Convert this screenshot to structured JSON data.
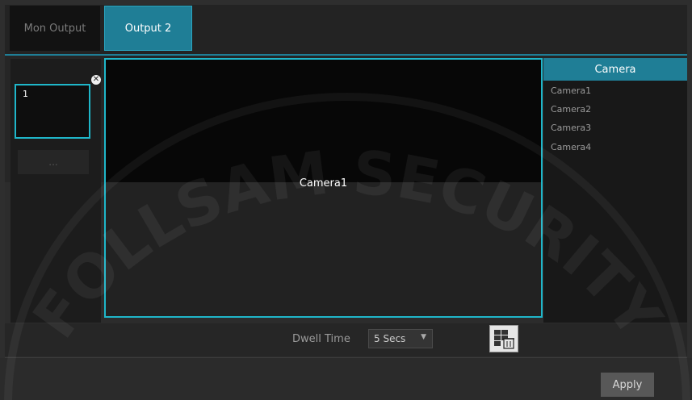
{
  "tabs": [
    {
      "label": "Mon Output"
    },
    {
      "label": "Output 2"
    }
  ],
  "sequence": {
    "thumb_number": "1",
    "add_button_label": "..."
  },
  "preview": {
    "label": "Camera1"
  },
  "camera_list": {
    "header": "Camera",
    "items": [
      "Camera1",
      "Camera2",
      "Camera3",
      "Camera4"
    ]
  },
  "dwell": {
    "label": "Dwell Time",
    "value": "5 Secs"
  },
  "footer": {
    "apply_label": "Apply"
  },
  "watermark": {
    "text": "FOLLSAM SECURITY"
  },
  "colors": {
    "accent": "#1f7e96",
    "border_highlight": "#1fb6c9",
    "background": "#262626"
  },
  "icons": {
    "thumb_close": "close-icon",
    "dwell_dropdown": "chevron-down-icon",
    "clear": "grid-trash-icon"
  }
}
